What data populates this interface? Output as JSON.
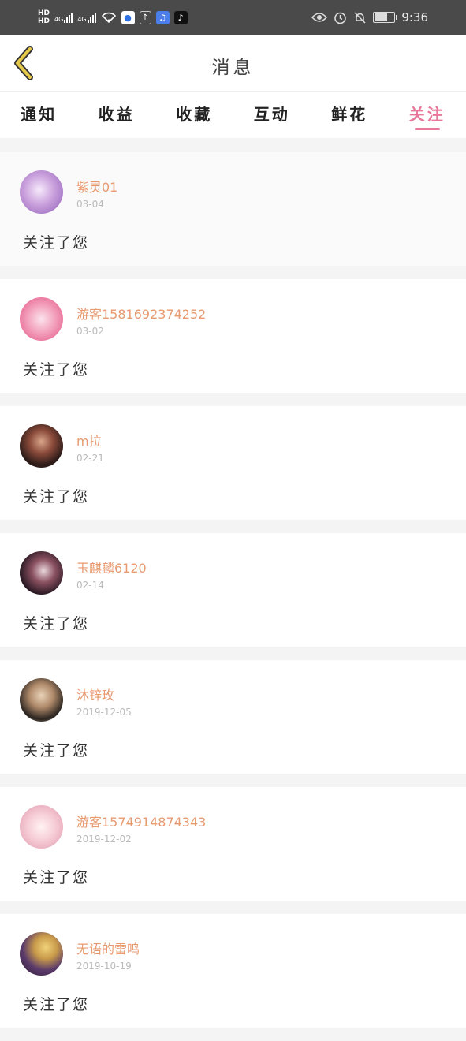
{
  "status_bar": {
    "hd1": "HD",
    "hd2": "HD",
    "net1": "4G",
    "net2": "4G",
    "time": "9:36",
    "icons": [
      "wifi-icon",
      "baidu-icon",
      "upload-icon",
      "music-icon",
      "tiktok-icon",
      "eye-icon",
      "alarm-icon",
      "bell-off-icon",
      "battery-icon"
    ]
  },
  "header": {
    "title": "消息"
  },
  "tabs": [
    {
      "label": "通知"
    },
    {
      "label": "收益"
    },
    {
      "label": "收藏"
    },
    {
      "label": "互动"
    },
    {
      "label": "鲜花"
    },
    {
      "label": "关注",
      "active": true
    }
  ],
  "messages": [
    {
      "name": "紫灵01",
      "date": "03-04",
      "text": "关注了您",
      "avatar": "purple-rose"
    },
    {
      "name": "游客1581692374252",
      "date": "03-02",
      "text": "关注了您",
      "avatar": "pink-gift"
    },
    {
      "name": "m拉",
      "date": "02-21",
      "text": "关注了您",
      "avatar": "girl-portrait"
    },
    {
      "name": "玉麒麟6120",
      "date": "02-14",
      "text": "关注了您",
      "avatar": "anime-dark"
    },
    {
      "name": "沐锌玫",
      "date": "2019-12-05",
      "text": "关注了您",
      "avatar": "girl-black"
    },
    {
      "name": "游客1574914874343",
      "date": "2019-12-02",
      "text": "关注了您",
      "avatar": "pink-flowers"
    },
    {
      "name": "无语的雷鸣",
      "date": "2019-10-19",
      "text": "关注了您",
      "avatar": "anime-blonde"
    }
  ],
  "colors": {
    "accent": "#e8779b",
    "username": "#e89a70",
    "back_arrow": "#e6c94a"
  }
}
